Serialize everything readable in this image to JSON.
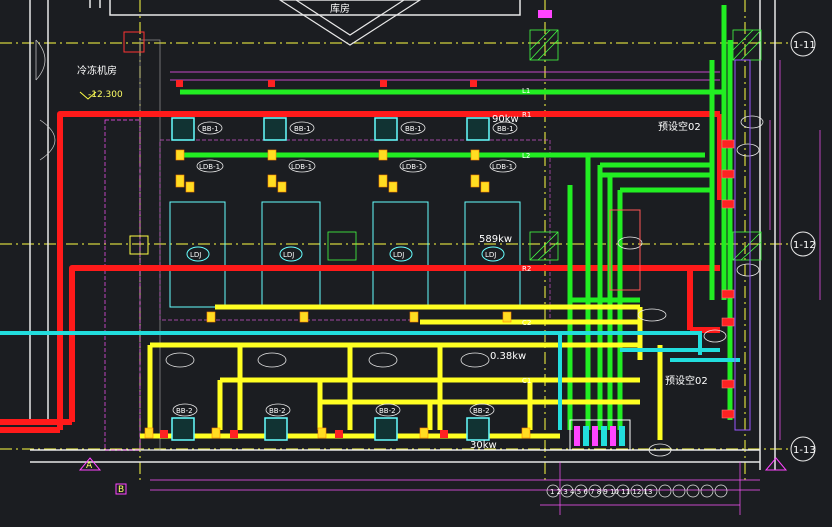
{
  "drawing": {
    "room_library": "库房",
    "room_chiller": "冷冻机房",
    "elevation": "-12.300",
    "room_reserved_1": "预设空02",
    "room_reserved_2": "预设空02",
    "power_1": "90kw",
    "power_2": "589kw",
    "power_3": "0.38kw",
    "power_4": "30kw",
    "axis_1": "1-11",
    "axis_2": "1-12",
    "axis_3": "1-13",
    "axis_4": "A",
    "axis_5": "B",
    "legend_text": "1 2 3 4 5 6 7 8 9 10 11 12 13",
    "chillers": [
      "LDJ",
      "LDJ",
      "LDJ",
      "LDJ"
    ],
    "pumps_top": [
      "BB-1",
      "BB-1",
      "BB-1",
      "BB-1"
    ],
    "pumps_mid": [
      "LDB-1",
      "LDB-1",
      "LDB-1",
      "LDB-1"
    ],
    "pumps_bottom": [
      "BB-2",
      "BB-2",
      "BB-2",
      "BB-2"
    ],
    "pipe_tags": [
      "L1",
      "L2",
      "R1",
      "R2",
      "C1",
      "C2"
    ],
    "colors": {
      "background": "#1b1d21",
      "hot_pipe": "#ff1a1a",
      "cold_pipe": "#22ee22",
      "cooling_pipe": "#ffff22",
      "makeup_pipe": "#22dddd",
      "equipment": "#66ffff",
      "dims": "#ff55ff",
      "grid": "#ffff44",
      "wall": "#ffffff"
    }
  }
}
